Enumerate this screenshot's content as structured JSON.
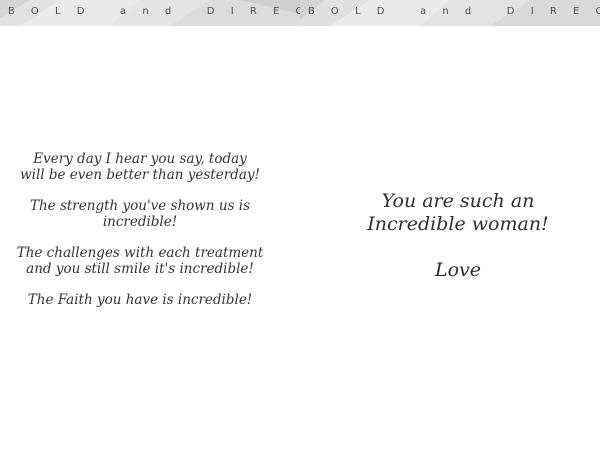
{
  "banner": {
    "left_text": "BOLD and DIRECT",
    "right_text": "BOLD and DIREC"
  },
  "left_page": {
    "verses": [
      [
        "Every day I hear you say, today",
        "will be even better than yesterday!"
      ],
      [
        "The strength you've shown us is",
        "incredible!"
      ],
      [
        "The challenges with each treatment",
        "and you still smile it's incredible!"
      ],
      [
        "The Faith you have is incredible!"
      ]
    ]
  },
  "right_page": {
    "message_lines": [
      "You are such an",
      "Incredible woman!"
    ],
    "signature": "Love"
  },
  "colors": {
    "banner_bg": "#ececec",
    "banner_text": "#505050",
    "verse_text": "#333333",
    "background": "#ffffff"
  }
}
